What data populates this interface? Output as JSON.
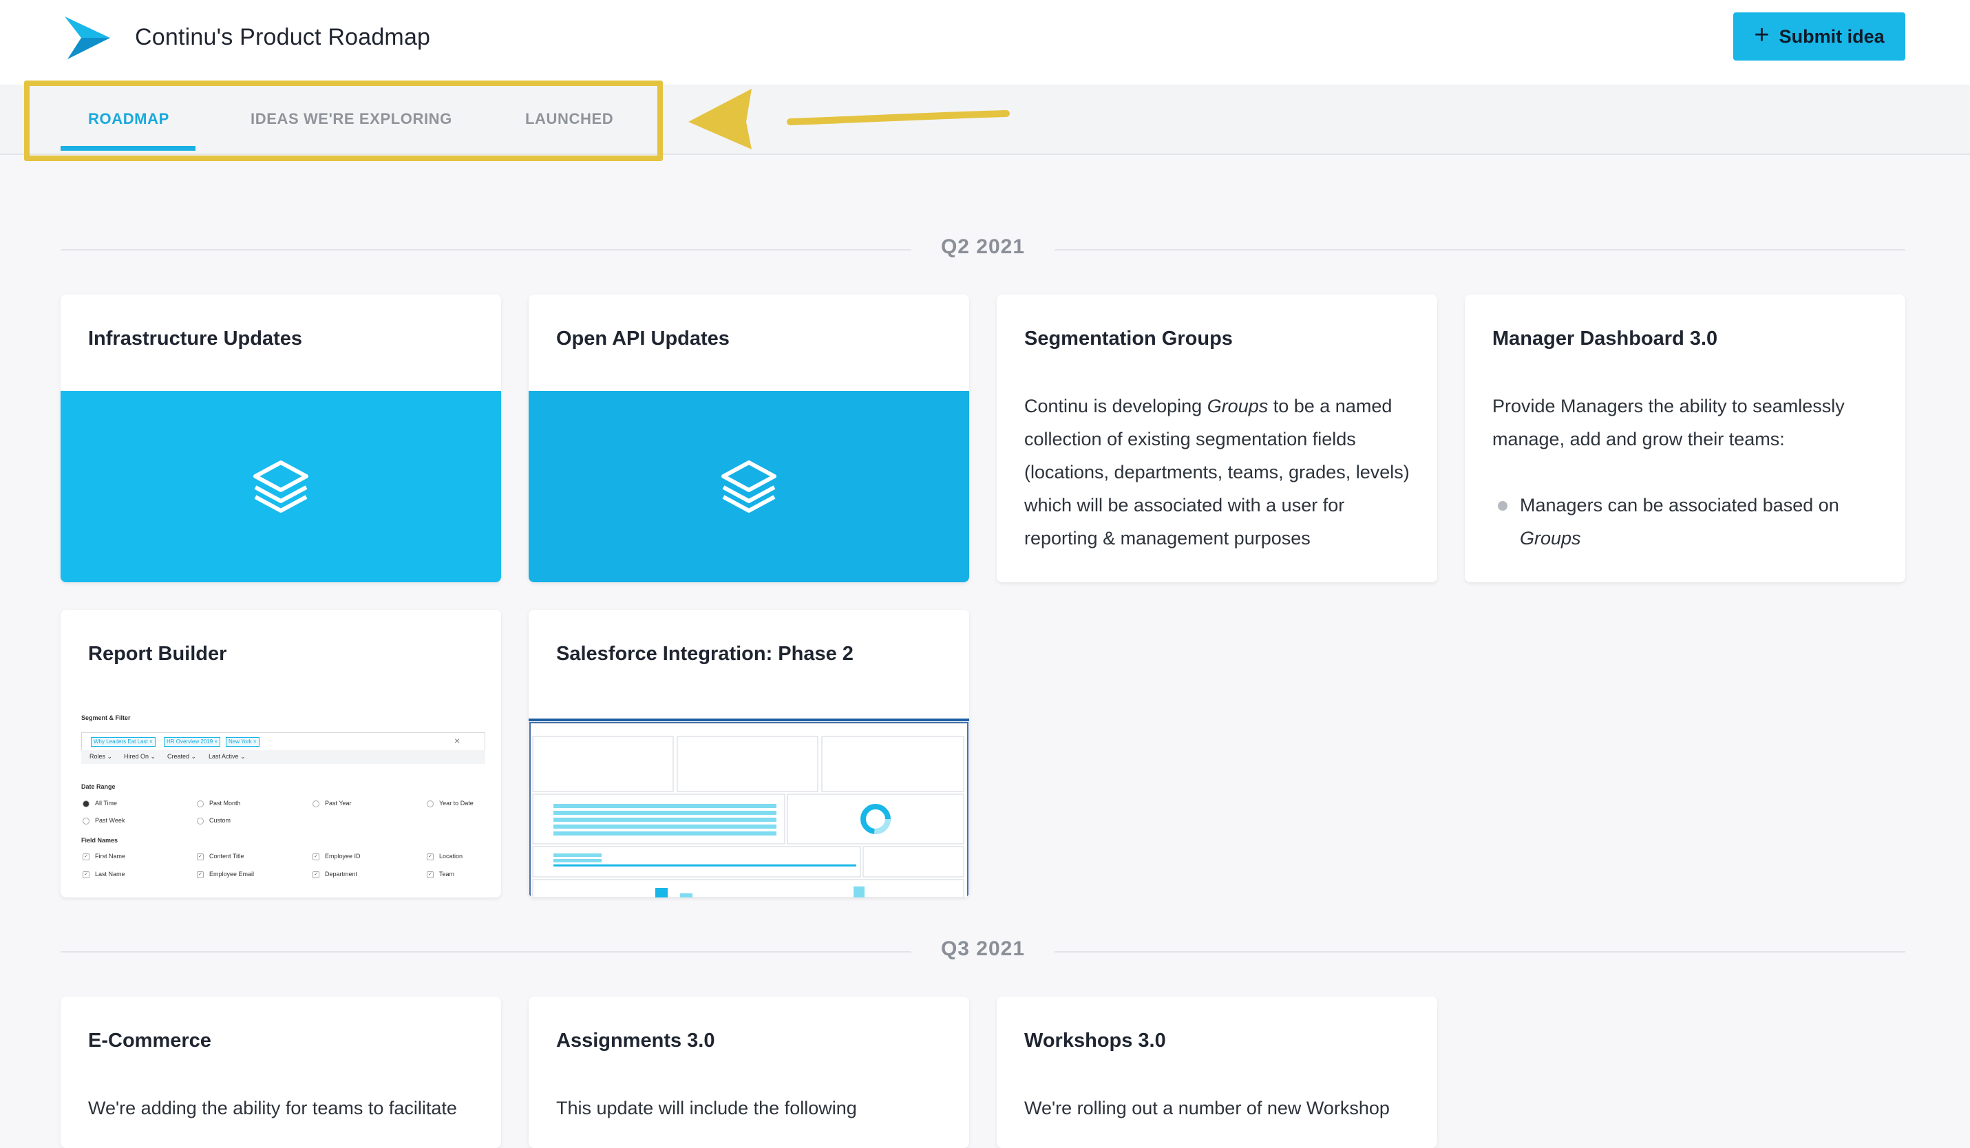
{
  "header": {
    "title": "Continu's Product Roadmap",
    "submit_label": "Submit idea",
    "submit_icon": "plus-icon",
    "logo_icon": "continu-logo-icon"
  },
  "tabs": [
    {
      "label": "ROADMAP",
      "active": true
    },
    {
      "label": "IDEAS WE'RE EXPLORING",
      "active": false
    },
    {
      "label": "LAUNCHED",
      "active": false
    }
  ],
  "colors": {
    "accent": "#19b6e8",
    "highlight": "#e4c340",
    "background": "#f7f7f9"
  },
  "sections": [
    {
      "label": "Q2 2021",
      "cards": [
        {
          "title": "Infrastructure Updates",
          "image": "layers-icon"
        },
        {
          "title": "Open API Updates",
          "image": "layers-icon"
        },
        {
          "title": "Segmentation Groups",
          "desc_parts": [
            "Continu is developing ",
            "Groups",
            " to be a named collection of existing segmentation fields (locations, departments, teams, grades, levels) which will be associated with a user for reporting & management purposes"
          ]
        },
        {
          "title": "Manager Dashboard 3.0",
          "desc": "Provide Managers the ability to seamlessly manage, add and grow their teams:",
          "bullet_parts": [
            "Managers can be associated based on ",
            "Groups"
          ]
        },
        {
          "title": "Report Builder",
          "screenshot": {
            "segment_label": "Segment & Filter",
            "chips": [
              "Why Leaders Eat Last ×",
              "HR Overview 2019 ×",
              "New York ×"
            ],
            "filters": [
              "Roles ⌄",
              "Hired On ⌄",
              "Created ⌄",
              "Last Active ⌄"
            ],
            "date_range_label": "Date Range",
            "date_options": [
              "All Time",
              "Past Month",
              "Past Year",
              "Year to Date",
              "Past Week",
              "Custom"
            ],
            "field_names_label": "Field Names",
            "fields": [
              "First Name",
              "Content Title",
              "Employee ID",
              "Location",
              "Last Name",
              "Employee Email",
              "Department",
              "Team"
            ]
          }
        },
        {
          "title": "Salesforce Integration: Phase 2",
          "screenshot": {
            "kind": "salesforce-dashboard"
          }
        }
      ]
    },
    {
      "label": "Q3 2021",
      "cards": [
        {
          "title": "E-Commerce",
          "desc": "We're adding the ability for teams to facilitate"
        },
        {
          "title": "Assignments 3.0",
          "desc": "This update will include the following"
        },
        {
          "title": "Workshops 3.0",
          "desc": "We're rolling out a number of new Workshop"
        }
      ]
    }
  ]
}
